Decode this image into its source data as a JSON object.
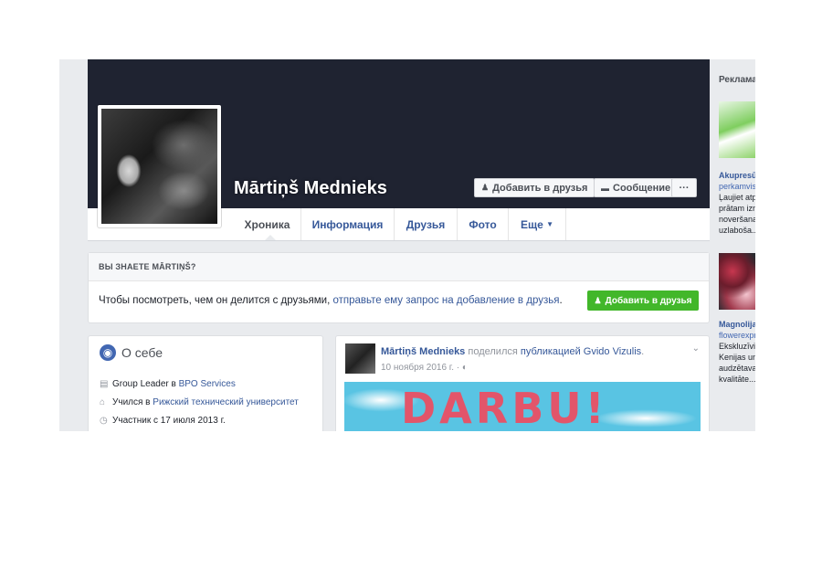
{
  "profile": {
    "name": "Mārtiņš Mednieks",
    "add_friend": "Добавить в друзья",
    "message": "Сообщение",
    "more": "···"
  },
  "tabs": [
    "Хроника",
    "Информация",
    "Друзья",
    "Фото",
    "Еще"
  ],
  "know": {
    "heading": "ВЫ ЗНАЕТЕ MĀRTIŅŠ?",
    "text_before": "Чтобы посмотреть, чем он делится с друзьями,",
    "link": "отправьте ему запрос на добавление в друзья",
    "text_after": ".",
    "button": "Добавить в друзья"
  },
  "about": {
    "title": "О себе",
    "rows": [
      {
        "icon": "briefcase-icon",
        "prefix": "Group Leader в",
        "link": "BPO Services"
      },
      {
        "icon": "graduation-cap-icon",
        "prefix": "Учился в",
        "link": "Рижский технический университет"
      },
      {
        "icon": "clock-icon",
        "prefix": "Участник с 17 июля 2013 г.",
        "link": ""
      }
    ]
  },
  "post": {
    "author": "Mārtiņš Mednieks",
    "action": "поделился",
    "link": "публикацией",
    "target": "Gvido Vizulis",
    "dot": ".",
    "date": "10 ноября 2016 г.",
    "sep": "·",
    "image_text": "DARBU!"
  },
  "ads": {
    "title": "Реклама",
    "ad1": {
      "title": "Akupresū",
      "domain": "perkamvis",
      "lines": [
        "Ļaujiet atp",
        "prātam izn",
        "noveršana",
        "uzlaboša..."
      ]
    },
    "ad2": {
      "title": "Magnolija",
      "domain": "flowerexpr",
      "lines": [
        "Ekskluzīvi",
        "Kenijas un",
        "audzētava",
        "kvalitāte..."
      ]
    }
  }
}
